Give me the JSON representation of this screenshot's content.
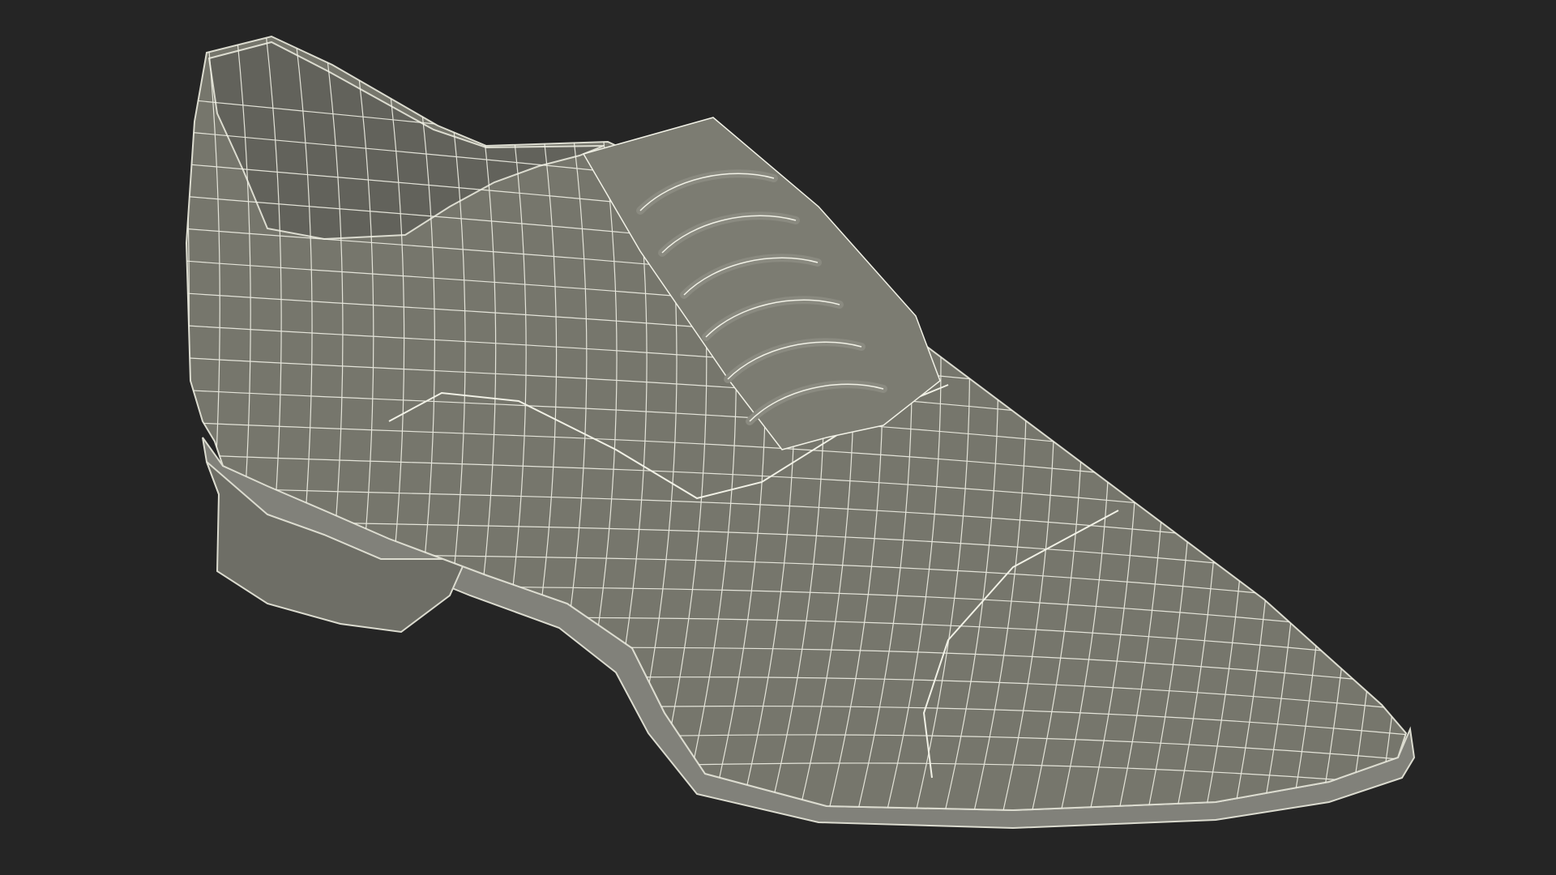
{
  "scene": {
    "subject": "shoe-wireframe",
    "colors": {
      "background": "#252525",
      "surface": "#76766c",
      "surface_dark": "#5f5f57",
      "interior": "#6b6b62",
      "sole": "#81817a",
      "wire": "#f1f1e6",
      "outline": "#dcdcd0"
    },
    "lacing": {
      "rows": 6
    }
  }
}
